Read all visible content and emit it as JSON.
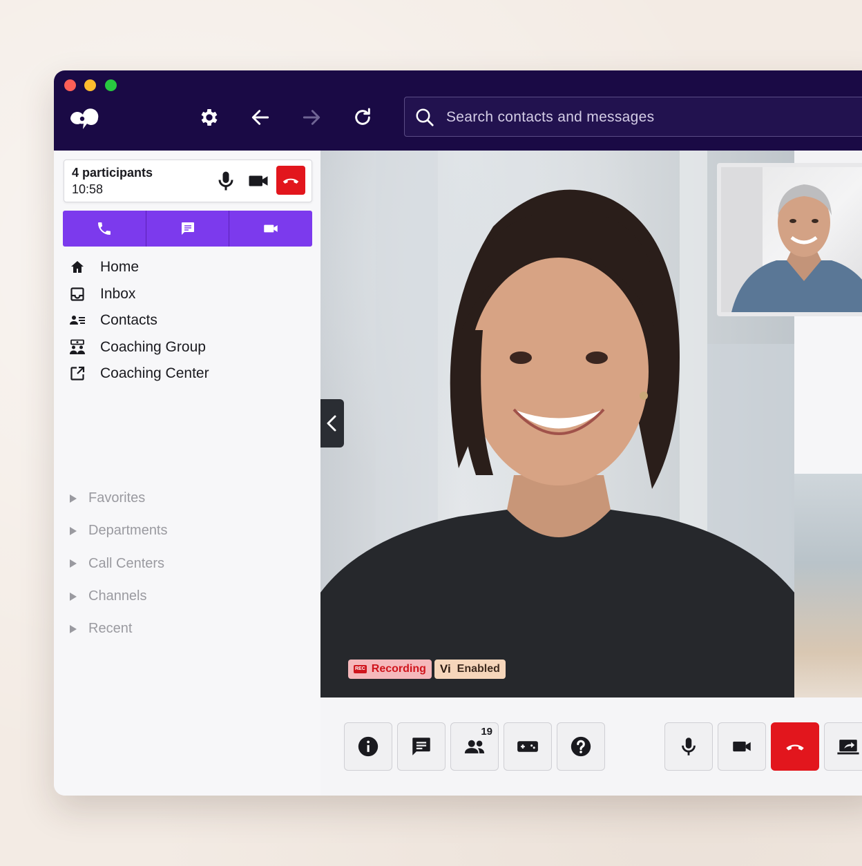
{
  "search": {
    "placeholder": "Search contacts and messages"
  },
  "call": {
    "participants": "4 participants",
    "timer": "10:58"
  },
  "nav": [
    {
      "label": "Home",
      "icon": "home-icon"
    },
    {
      "label": "Inbox",
      "icon": "inbox-icon"
    },
    {
      "label": "Contacts",
      "icon": "contacts-icon"
    },
    {
      "label": "Coaching Group",
      "icon": "coaching-group-icon"
    },
    {
      "label": "Coaching Center",
      "icon": "external-link-icon"
    }
  ],
  "sections": [
    "Favorites",
    "Departments",
    "Call Centers",
    "Channels",
    "Recent"
  ],
  "badges": {
    "recording": "Recording",
    "rec_mark": "REC",
    "vi_mark": "Vi",
    "enabled": "Enabled"
  },
  "participants_count": "19",
  "colors": {
    "titlebar": "#1a0a45",
    "accent": "#7c3aed",
    "hangup": "#e2161d"
  }
}
